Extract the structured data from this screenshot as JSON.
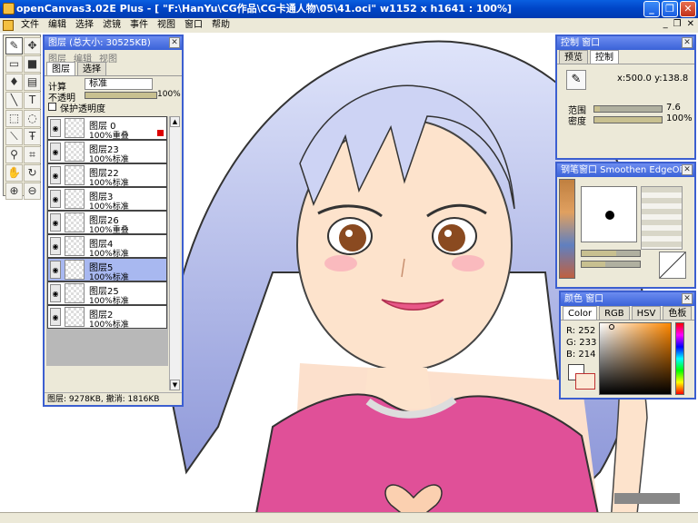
{
  "window": {
    "title": "openCanvas3.02E Plus - [ \"F:\\HanYu\\CG作品\\CG卡通人物\\05\\41.oci\" w1152 x h1641 : 100%]",
    "buttons": [
      "_",
      "❐",
      "✕"
    ]
  },
  "menu": {
    "items": [
      "文件",
      "编辑",
      "选择",
      "滤镜",
      "事件",
      "视图",
      "窗口",
      "帮助"
    ],
    "mdi_controls": [
      "_",
      "❐",
      "✕"
    ]
  },
  "layers_panel": {
    "title": "图层 (总大小: 30525KB)",
    "submenu": [
      "图层",
      "编辑",
      "视图"
    ],
    "tabs": [
      "图层",
      "选择"
    ],
    "calc_label": "计算",
    "calc_value": "标准",
    "opacity_label": "不透明",
    "opacity_value": "100%",
    "opacity": 1.0,
    "protect_label": "保护透明度",
    "layers": [
      {
        "name": "图层 0",
        "mode": "100%重叠",
        "selected": false
      },
      {
        "name": "图层23",
        "mode": "100%标准",
        "selected": false
      },
      {
        "name": "图层22",
        "mode": "100%标准",
        "selected": false
      },
      {
        "name": "图层3",
        "mode": "100%标准",
        "selected": false
      },
      {
        "name": "图层26",
        "mode": "100%重叠",
        "selected": false
      },
      {
        "name": "图层4",
        "mode": "100%标准",
        "selected": false
      },
      {
        "name": "图层5",
        "mode": "100%标准",
        "selected": true
      },
      {
        "name": "图层25",
        "mode": "100%标准",
        "selected": false
      },
      {
        "name": "图层2",
        "mode": "100%标准",
        "selected": false
      }
    ],
    "footer": "图层: 9278KB, 撤消: 1816KB"
  },
  "control_panel": {
    "title": "控制 窗口",
    "tabs": [
      "预览",
      "控制"
    ],
    "coords": "x:500.0 y:138.8",
    "range_label": "范围",
    "range_value": "7.6",
    "density_label": "密度",
    "density_value": "100%",
    "density": 1.0
  },
  "brush_panel": {
    "title": "钢笔窗口  Smoothen EdgeOFF"
  },
  "color_panel": {
    "title": "颜色 窗口",
    "tabs": [
      "Color",
      "RGB",
      "HSV",
      "色板"
    ],
    "r_label": "R: 252",
    "g_label": "G: 233",
    "b_label": "B: 214",
    "current_color": "#fce9d6"
  }
}
